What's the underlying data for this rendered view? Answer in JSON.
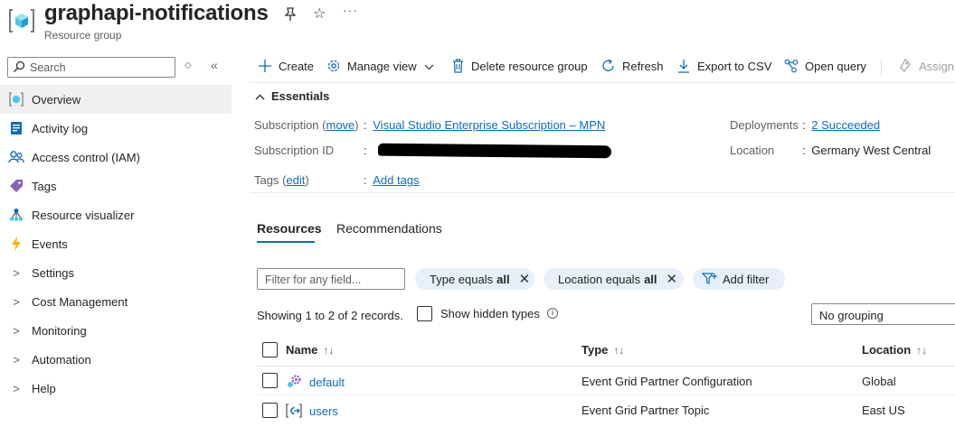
{
  "header": {
    "title": "graphapi-notifications",
    "subtitle": "Resource group"
  },
  "sidebar": {
    "search_placeholder": "Search",
    "items": [
      {
        "label": "Overview",
        "icon": "resource-group-icon",
        "active": true
      },
      {
        "label": "Activity log",
        "icon": "activity-log-icon"
      },
      {
        "label": "Access control (IAM)",
        "icon": "iam-people-icon"
      },
      {
        "label": "Tags",
        "icon": "tag-icon"
      },
      {
        "label": "Resource visualizer",
        "icon": "visualizer-icon"
      },
      {
        "label": "Events",
        "icon": "lightning-icon"
      },
      {
        "label": "Settings",
        "expandable": true
      },
      {
        "label": "Cost Management",
        "expandable": true
      },
      {
        "label": "Monitoring",
        "expandable": true
      },
      {
        "label": "Automation",
        "expandable": true
      },
      {
        "label": "Help",
        "expandable": true
      }
    ]
  },
  "toolbar": {
    "create": "Create",
    "manage_view": "Manage view",
    "delete": "Delete resource group",
    "refresh": "Refresh",
    "export": "Export to CSV",
    "open_query": "Open query",
    "assign": "Assign"
  },
  "essentials": {
    "title": "Essentials",
    "subscription_label": "Subscription",
    "subscription_move": "move",
    "subscription_value": "Visual Studio Enterprise Subscription – MPN",
    "subscription_id_label": "Subscription ID",
    "tags_label": "Tags",
    "tags_edit": "edit",
    "tags_value": "Add tags",
    "deployments_label": "Deployments",
    "deployments_value": "2 Succeeded",
    "location_label": "Location",
    "location_value": "Germany West Central"
  },
  "tabs": {
    "resources": "Resources",
    "recommendations": "Recommendations"
  },
  "filters": {
    "placeholder": "Filter for any field...",
    "type_label": "Type equals",
    "type_value": "all",
    "location_label": "Location equals",
    "location_value": "all",
    "add_filter": "Add filter"
  },
  "records_text": "Showing 1 to 2 of 2 records.",
  "show_hidden": "Show hidden types",
  "grouping": "No grouping",
  "table": {
    "columns": {
      "name": "Name",
      "type": "Type",
      "location": "Location"
    },
    "rows": [
      {
        "name": "default",
        "type": "Event Grid Partner Configuration",
        "location": "Global",
        "icon": "partner-config-icon"
      },
      {
        "name": "users",
        "type": "Event Grid Partner Topic",
        "location": "East US",
        "icon": "partner-topic-icon"
      }
    ]
  }
}
